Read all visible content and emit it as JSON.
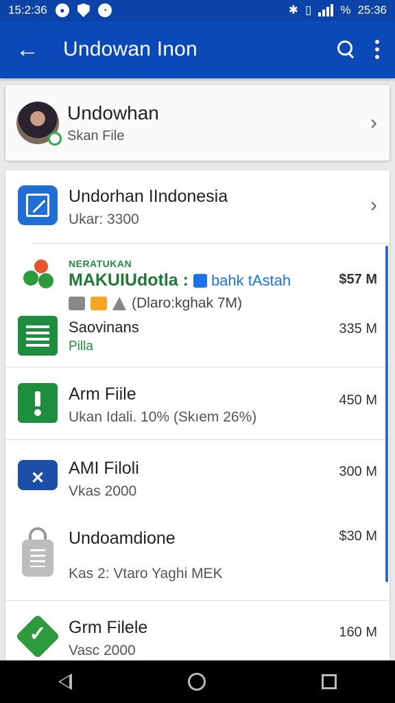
{
  "status_bar": {
    "time": "15:2:36",
    "clock_right": "25:36",
    "battery_text": "%"
  },
  "app_bar": {
    "title": "Undowan Inon"
  },
  "account_card": {
    "name": "Undowhan",
    "subtitle": "Skan File"
  },
  "list": {
    "items": [
      {
        "title": "Undorhan IIndonesia",
        "subtitle": "Ukar: 3300",
        "size": ""
      },
      {
        "tag": "NERATUKAN",
        "title": "MAKUIUdotla :",
        "link": "bahk tAstah",
        "meta": "(Dlaro:kghak 7M)",
        "size": "$57 M"
      },
      {
        "title": "Saovinans",
        "subtitle": "Pilla",
        "size": "335 M"
      },
      {
        "title": "Arm Fiile",
        "subtitle": "Ukan Idali. 10% (Skıem 26%)",
        "size": "450 M"
      },
      {
        "title": "AMI Filoli",
        "subtitle": "Vkas 2000",
        "size": "300 M"
      },
      {
        "title": "Undoamdione",
        "subtitle": "Kas 2: Vtaro Yaghi MEK",
        "size": "$30 M"
      },
      {
        "title": "Grm Filele",
        "subtitle": "Vasc 2000",
        "size": "160 M"
      }
    ]
  },
  "icons": {
    "back": "arrow-left-icon",
    "search": "search-icon",
    "more": "more-vert-icon"
  }
}
